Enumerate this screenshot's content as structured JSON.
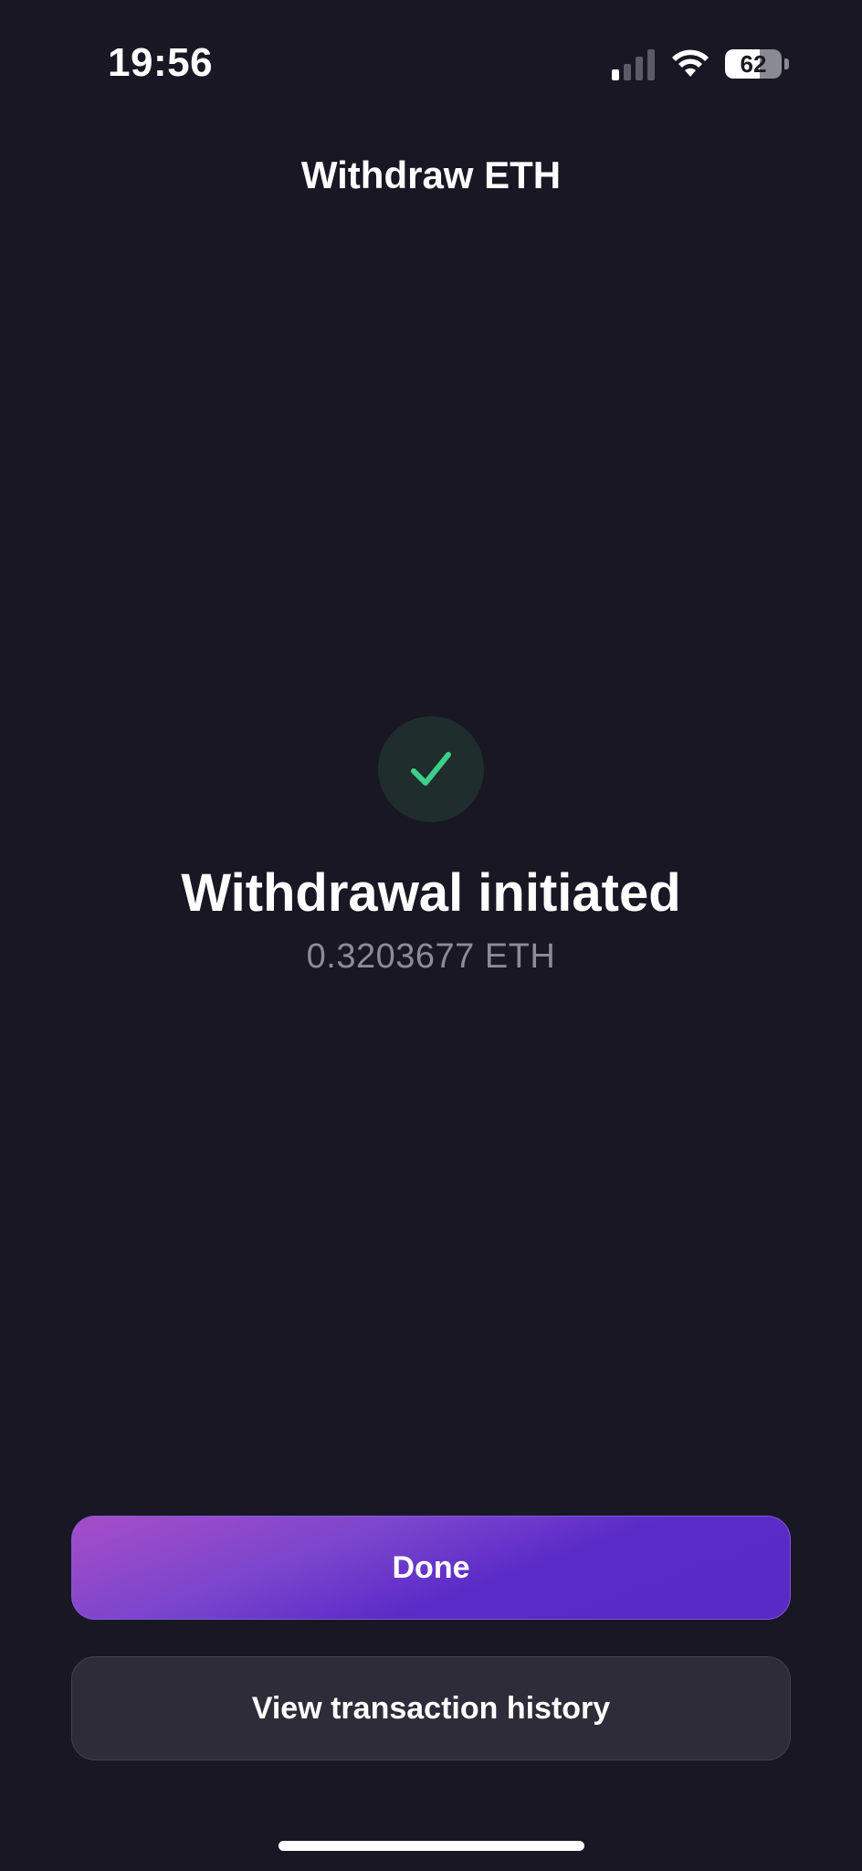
{
  "status_bar": {
    "time": "19:56",
    "battery_level": "62",
    "battery_fraction": 0.62,
    "icons": [
      "signal-icon",
      "wifi-icon",
      "battery-icon"
    ]
  },
  "header": {
    "title": "Withdraw ETH"
  },
  "success": {
    "icon": "check-icon",
    "title": "Withdrawal initiated",
    "amount": "0.3203677 ETH"
  },
  "actions": {
    "done_label": "Done",
    "history_label": "View transaction history"
  },
  "colors": {
    "background": "#181723",
    "accent_purple": "#5b2bc8",
    "accent_magenta": "#a64ec8",
    "success_green": "#3ccf8a",
    "muted_text": "#8d8b98"
  }
}
